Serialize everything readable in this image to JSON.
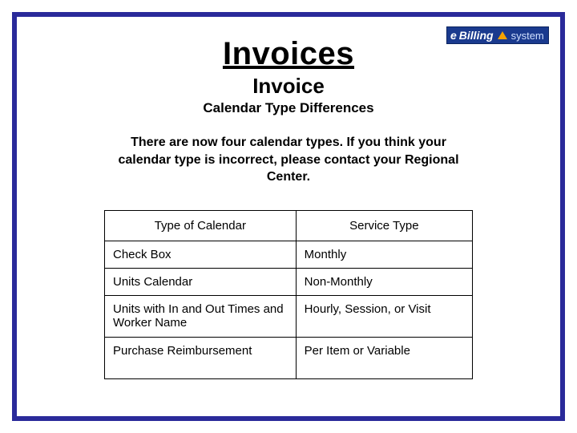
{
  "logo": {
    "e": "e",
    "billing": "Billing",
    "system": "system"
  },
  "titles": {
    "main": "Invoices",
    "sub": "Invoice",
    "sub2": "Calendar Type Differences"
  },
  "intro": "There are now four calendar types. If you think your calendar type is incorrect, please contact your Regional Center.",
  "table": {
    "headers": {
      "col1": "Type of Calendar",
      "col2": "Service Type"
    },
    "rows": [
      {
        "col1": "Check Box",
        "col2": "Monthly"
      },
      {
        "col1": "Units Calendar",
        "col2": "Non-Monthly"
      },
      {
        "col1": "Units with In and Out Times and Worker Name",
        "col2": "Hourly, Session, or Visit"
      },
      {
        "col1": "Purchase Reimbursement",
        "col2": "Per Item or Variable"
      }
    ]
  }
}
